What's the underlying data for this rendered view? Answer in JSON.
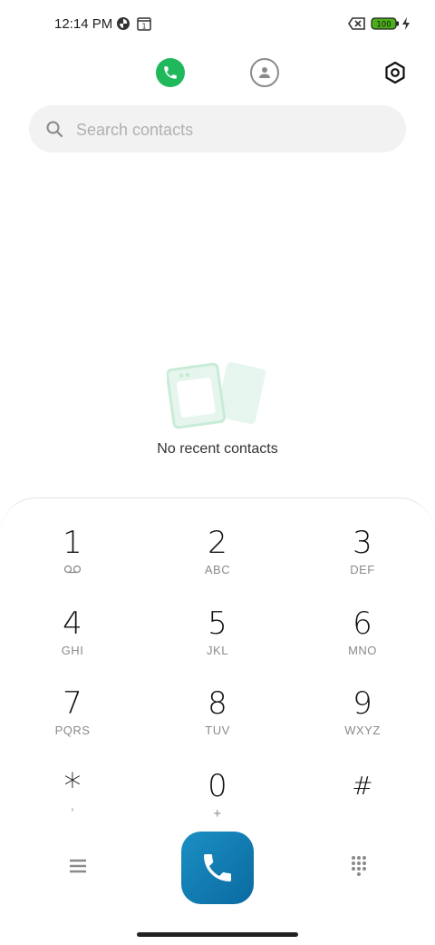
{
  "status_bar": {
    "time": "12:14 PM",
    "icons": [
      "pinwheel-icon",
      "calendar-icon",
      "battery-saver-x-icon",
      "battery-icon",
      "charging-bolt-icon"
    ],
    "calendar_day": "1",
    "battery_level": "100",
    "battery_color": "#4caf1a"
  },
  "tabs": [
    {
      "name": "phone",
      "icon": "phone-icon",
      "active": true,
      "color": "#1fb85a"
    },
    {
      "name": "contacts",
      "icon": "person-icon",
      "active": false
    }
  ],
  "settings_icon": "hexagon-settings-icon",
  "search": {
    "placeholder": "Search contacts",
    "value": ""
  },
  "empty_state": {
    "text": "No recent contacts"
  },
  "dialpad": {
    "keys": [
      {
        "digit": "1",
        "sub": "voicemail"
      },
      {
        "digit": "2",
        "sub": "ABC"
      },
      {
        "digit": "3",
        "sub": "DEF"
      },
      {
        "digit": "4",
        "sub": "GHI"
      },
      {
        "digit": "5",
        "sub": "JKL"
      },
      {
        "digit": "6",
        "sub": "MNO"
      },
      {
        "digit": "7",
        "sub": "PQRS"
      },
      {
        "digit": "8",
        "sub": "TUV"
      },
      {
        "digit": "9",
        "sub": "WXYZ"
      },
      {
        "digit": "*",
        "sub": ","
      },
      {
        "digit": "0",
        "sub": "+"
      },
      {
        "digit": "#",
        "sub": ""
      }
    ]
  },
  "bottom": {
    "menu_icon": "hamburger-menu-icon",
    "call_icon": "phone-call-icon",
    "call_color": "#1479b0",
    "keypad_icon": "dialpad-grid-icon"
  }
}
